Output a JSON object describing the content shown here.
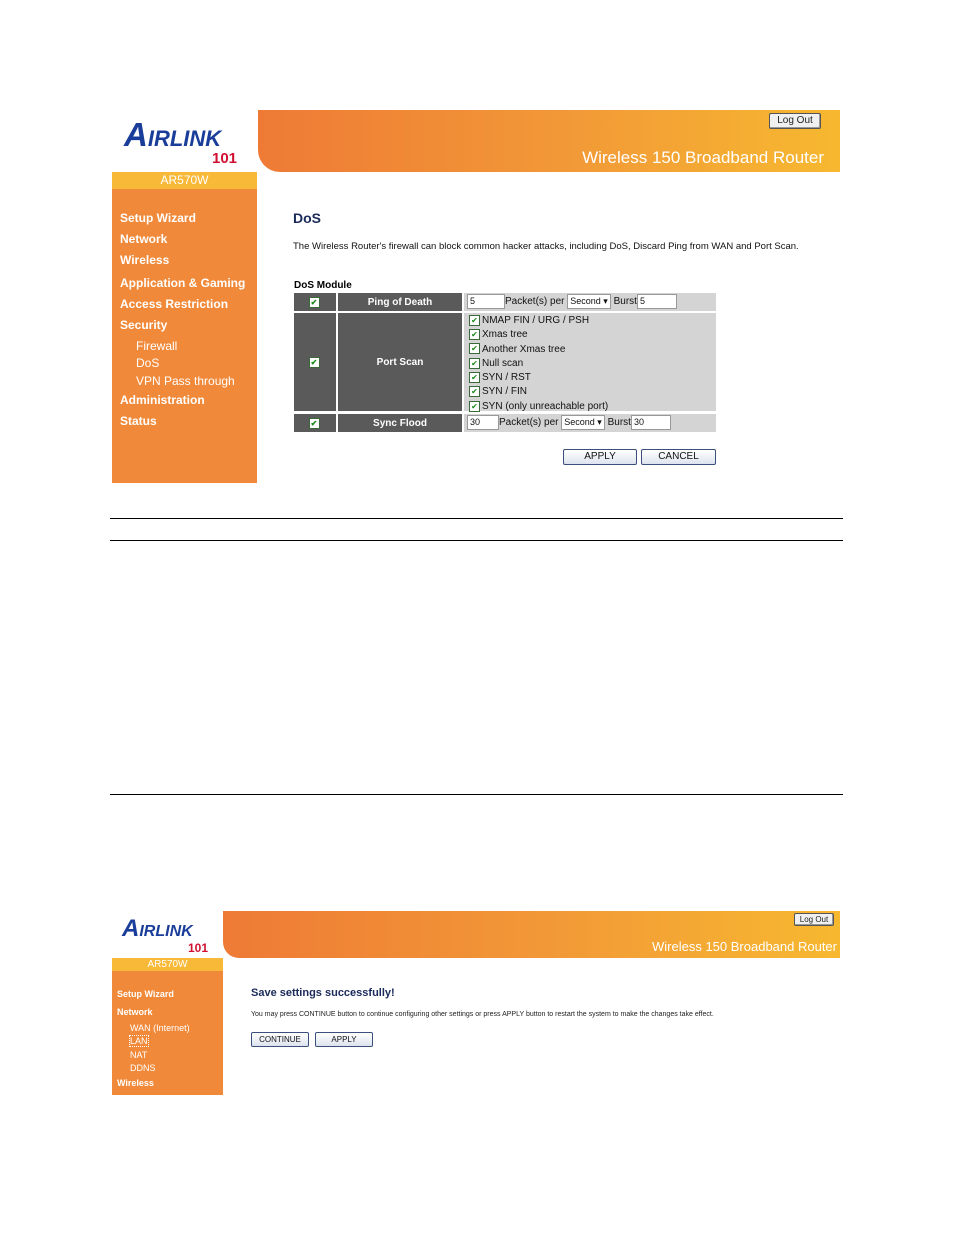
{
  "shot1": {
    "logo": "AIRLINK 101",
    "model": "AR570W",
    "banner_title": "Wireless 150 Broadband Router",
    "logout": "Log Out",
    "nav": [
      {
        "label": "Setup Wizard"
      },
      {
        "label": "Network"
      },
      {
        "label": "Wireless"
      },
      {
        "label": "Application & Gaming"
      },
      {
        "label": "Access Restriction"
      },
      {
        "label": "Security"
      }
    ],
    "security_sub": [
      {
        "label": "Firewall"
      },
      {
        "label": "DoS"
      },
      {
        "label": "VPN Pass through"
      }
    ],
    "nav_after": [
      {
        "label": "Administration"
      },
      {
        "label": "Status"
      }
    ],
    "page_title": "DoS",
    "description": "The Wireless Router's firewall can block common hacker attacks, including DoS, Discard Ping from WAN and Port Scan.",
    "module_label": "DoS Module",
    "ping": {
      "label": "Ping of Death",
      "enabled": true,
      "packets": "5",
      "per_label": "Packet(s) per",
      "unit": "Second",
      "burst_label": "Burst",
      "burst": "5"
    },
    "portscan": {
      "label": "Port Scan",
      "enabled": true,
      "options": [
        {
          "label": "NMAP FIN / URG / PSH",
          "checked": true
        },
        {
          "label": "Xmas tree",
          "checked": true
        },
        {
          "label": "Another Xmas tree",
          "checked": true
        },
        {
          "label": "Null scan",
          "checked": true
        },
        {
          "label": "SYN / RST",
          "checked": true
        },
        {
          "label": "SYN / FIN",
          "checked": true
        },
        {
          "label": "SYN (only unreachable port)",
          "checked": true
        }
      ]
    },
    "sync": {
      "label": "Sync Flood",
      "enabled": true,
      "packets": "30",
      "per_label": "Packet(s) per",
      "unit": "Second",
      "burst_label": "Burst",
      "burst": "30"
    },
    "apply": "APPLY",
    "cancel": "CANCEL"
  },
  "shot2": {
    "logo": "AIRLINK 101",
    "model": "AR570W",
    "banner_title": "Wireless 150 Broadband Router",
    "logout": "Log Out",
    "nav": [
      {
        "label": "Setup Wizard"
      },
      {
        "label": "Network"
      }
    ],
    "network_sub": [
      {
        "label": "WAN (Internet)"
      },
      {
        "label": "LAN"
      },
      {
        "label": "NAT"
      },
      {
        "label": "DDNS"
      }
    ],
    "nav_after": [
      {
        "label": "Wireless"
      }
    ],
    "title": "Save settings successfully!",
    "message": "You may press CONTINUE button to continue configuring other settings or press APPLY button to restart the system to make the changes take effect.",
    "continue": "CONTINUE",
    "apply": "APPLY"
  },
  "colors": {
    "sidebar": "#f08a3a",
    "model_bar": "#f9b938",
    "title_blue": "#1a2a5a"
  }
}
